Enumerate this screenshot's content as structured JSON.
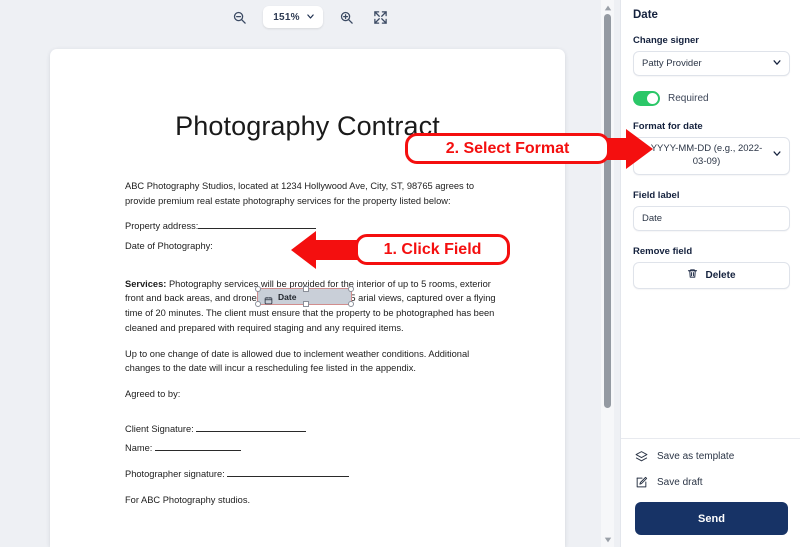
{
  "toolbar": {
    "zoom_out_icon": "zoom-out-icon",
    "zoom_level": "151%",
    "zoom_in_icon": "zoom-in-icon",
    "fullscreen_icon": "fullscreen-icon"
  },
  "document": {
    "title": "Photography Contract",
    "intro": "ABC Photography Studios, located at 1234 Hollywood Ave, City, ST, 98765 agrees to provide premium real estate photography services for the property listed below:",
    "property_address_label": "Property address:",
    "date_of_photography_label": "Date of Photography:",
    "services_heading": "Services:",
    "services_text": " Photography services will be provided for the interior of up to 5 rooms, exterior front and back areas, and drone photography for up to 5 arial views, captured over a flying time of 20 minutes. The client must ensure that the property to be photographed has been cleaned and prepared with required staging and any required items.",
    "reschedule_text": "Up to one change of date is allowed due to inclement weather conditions. Additional changes to the date will incur a rescheduling fee listed in the appendix.",
    "agreed_label": "Agreed to by:",
    "client_signature_label": "Client Signature:",
    "name_label": "Name:",
    "photographer_signature_label": "Photographer signature:",
    "footer_text": "For ABC Photography studios."
  },
  "field_widget": {
    "label": "Date",
    "icon": "calendar-icon"
  },
  "annotations": [
    {
      "id": "click-field",
      "text": "1. Click Field",
      "direction": "left",
      "color": "#f40f0f"
    },
    {
      "id": "select-format",
      "text": "2. Select Format",
      "direction": "right",
      "color": "#f40f0f"
    }
  ],
  "panel": {
    "title": "Date",
    "change_signer_label": "Change signer",
    "signer_value": "Patty Provider",
    "required_label": "Required",
    "required_on": true,
    "format_label": "Format for date",
    "format_value": "YYYY-MM-DD (e.g., 2022-03-09)",
    "field_label_label": "Field label",
    "field_label_value": "Date",
    "remove_field_label": "Remove field",
    "delete_label": "Delete",
    "delete_icon": "trash-icon",
    "save_template_label": "Save as template",
    "save_template_icon": "layers-icon",
    "save_draft_label": "Save draft",
    "save_draft_icon": "edit-pencil-icon",
    "send_label": "Send"
  },
  "colors": {
    "accent_navy": "#173366",
    "toggle_green": "#2bc768",
    "annotation_red": "#f40f0f",
    "canvas_bg": "#eef0f4"
  }
}
